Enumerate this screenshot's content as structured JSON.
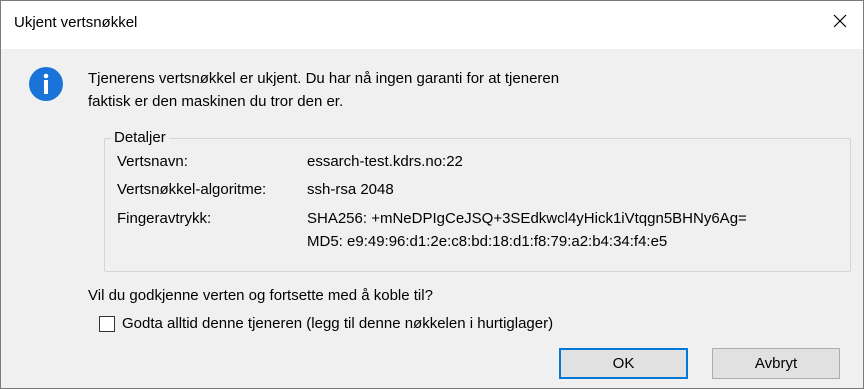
{
  "window": {
    "title": "Ukjent vertsnøkkel"
  },
  "message": {
    "line1": "Tjenerens vertsnøkkel er ukjent. Du har nå ingen garanti for at tjeneren",
    "line2": "faktisk er den maskinen du tror den er."
  },
  "details": {
    "legend": "Detaljer",
    "hostname_label": "Vertsnavn:",
    "hostname_value": "essarch-test.kdrs.no:22",
    "algorithm_label": "Vertsnøkkel-algoritme:",
    "algorithm_value": "ssh-rsa 2048",
    "fingerprint_label": "Fingeravtrykk:",
    "fingerprint_sha256": "SHA256: +mNeDPIgCeJSQ+3SEdkwcl4yHick1iVtqgn5BHNy6Ag=",
    "fingerprint_md5": "MD5: e9:49:96:d1:2e:c8:bd:18:d1:f8:79:a2:b4:34:f4:e5"
  },
  "question": "Vil du godkjenne verten og fortsette med å koble til?",
  "checkbox": {
    "label": "Godta alltid denne tjeneren (legg til denne nøkkelen i hurtiglager)",
    "checked": false
  },
  "buttons": {
    "ok": "OK",
    "cancel": "Avbryt"
  },
  "icons": {
    "info": "info-icon",
    "close": "close-icon"
  },
  "colors": {
    "accent": "#0078d7",
    "info": "#1a73d9"
  }
}
